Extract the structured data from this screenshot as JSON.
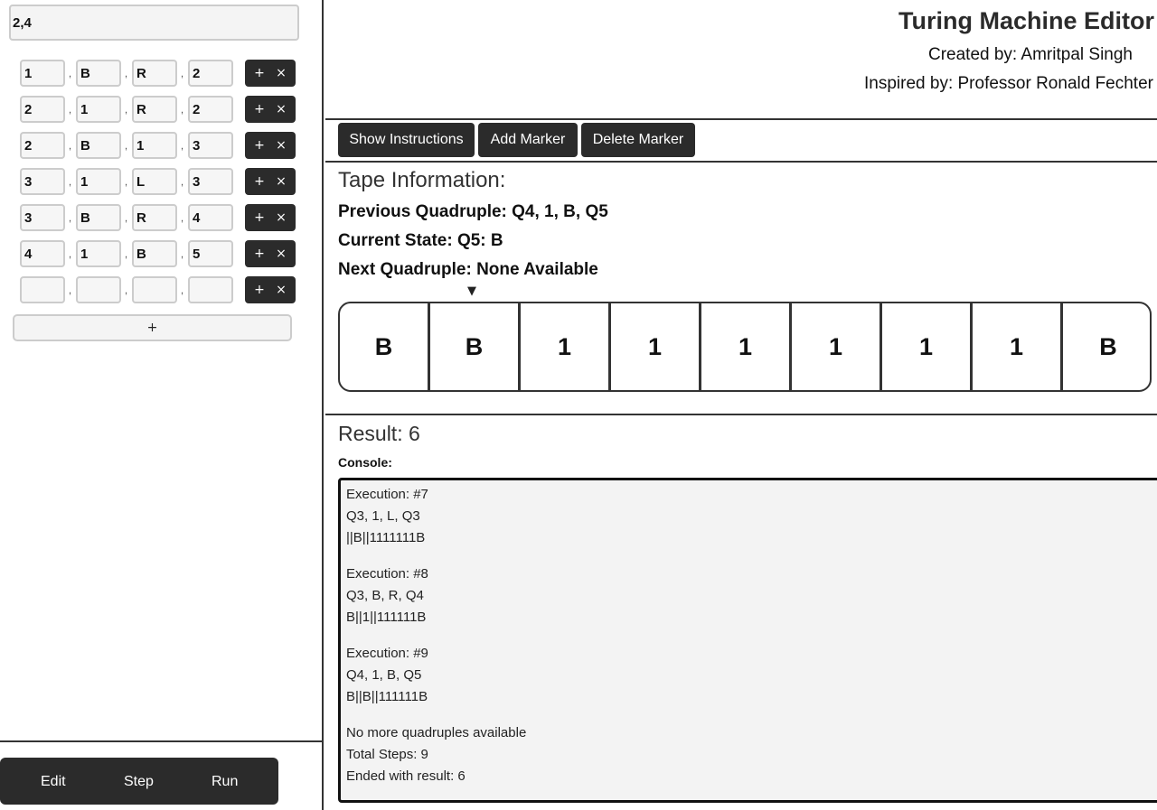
{
  "left": {
    "main_input": "2,4",
    "quadruples": [
      [
        "1",
        "B",
        "R",
        "2"
      ],
      [
        "2",
        "1",
        "R",
        "2"
      ],
      [
        "2",
        "B",
        "1",
        "3"
      ],
      [
        "3",
        "1",
        "L",
        "3"
      ],
      [
        "3",
        "B",
        "R",
        "4"
      ],
      [
        "4",
        "1",
        "B",
        "5"
      ],
      [
        "",
        "",
        "",
        ""
      ]
    ],
    "comma": ",",
    "plus_label": "+",
    "remove_label": "×",
    "add_row_label": "+",
    "controls": {
      "edit": "Edit",
      "step": "Step",
      "run": "Run"
    }
  },
  "header": {
    "title": "Turing Machine Editor",
    "created_by": "Created by: Amritpal Singh",
    "inspired_by": "Inspired by: Professor Ronald Fechter"
  },
  "toolbar": {
    "show_instructions": "Show Instructions",
    "add_marker": "Add Marker",
    "delete_marker": "Delete Marker"
  },
  "tape_info": {
    "heading": "Tape Information:",
    "previous": "Previous Quadruple: Q4, 1, B, Q5",
    "current": "Current State: Q5: B",
    "next": "Next Quadruple: None Available",
    "marker": "▼"
  },
  "tape": [
    "B",
    "B",
    "1",
    "1",
    "1",
    "1",
    "1",
    "1",
    "B"
  ],
  "result": "Result: 6",
  "console": {
    "label": "Console:",
    "blocks": [
      [
        "Execution: #7",
        "Q3, 1, L, Q3",
        "||B||1111111B"
      ],
      [
        "Execution: #8",
        "Q3, B, R, Q4",
        "B||1||111111B"
      ],
      [
        "Execution: #9",
        "Q4, 1, B, Q5",
        "B||B||111111B"
      ],
      [
        "No more quadruples available",
        "Total Steps: 9",
        "Ended with result: 6"
      ]
    ]
  }
}
